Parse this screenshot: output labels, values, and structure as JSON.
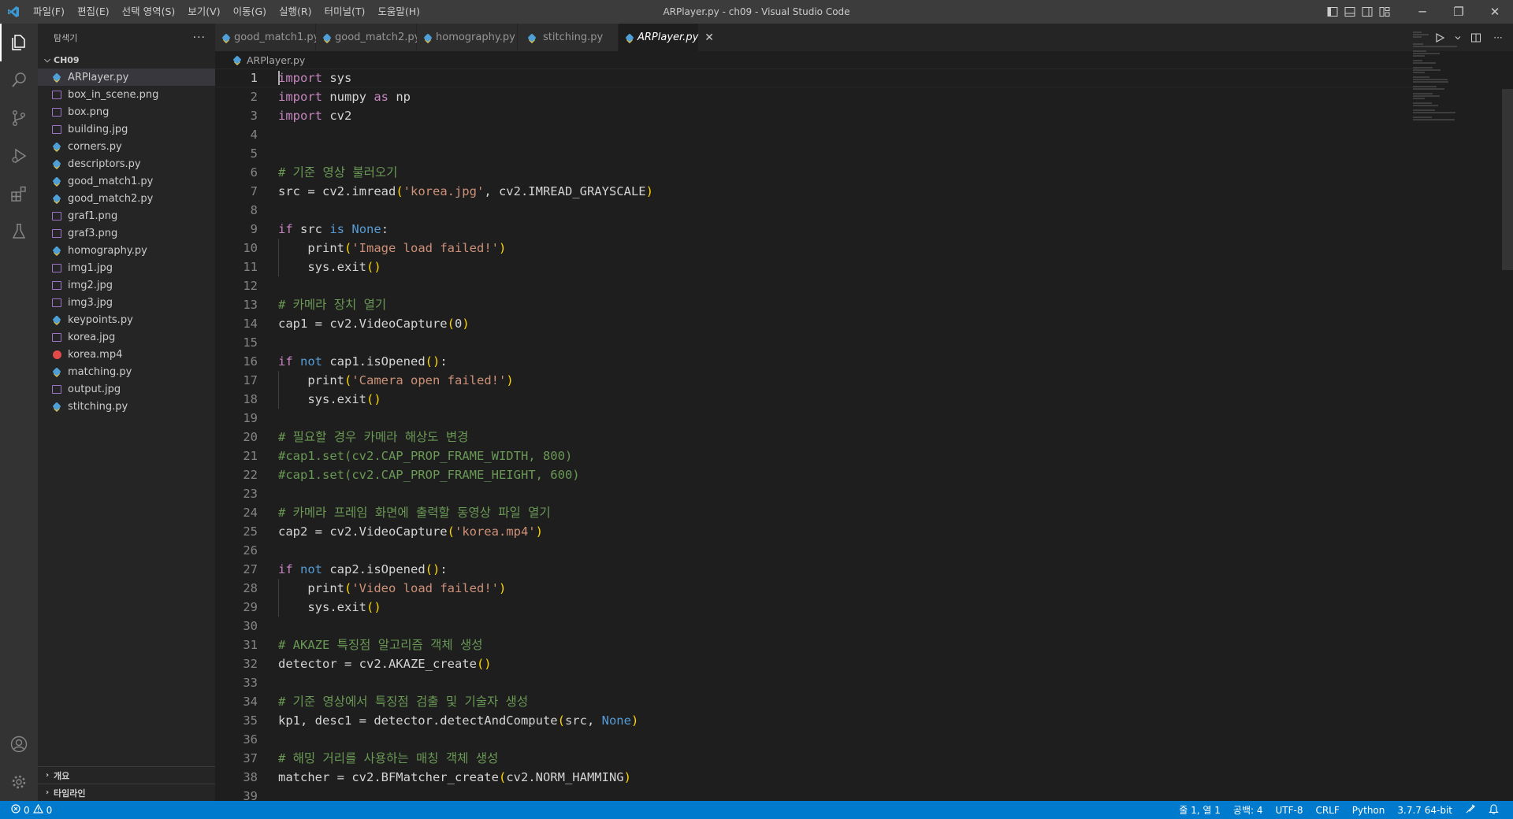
{
  "titlebar": {
    "title": "ARPlayer.py - ch09 - Visual Studio Code",
    "menu": [
      "파일(F)",
      "편집(E)",
      "선택 영역(S)",
      "보기(V)",
      "이동(G)",
      "실행(R)",
      "터미널(T)",
      "도움말(H)"
    ],
    "window_controls": {
      "minimize": "─",
      "restore": "❐",
      "close": "✕"
    }
  },
  "activitybar": {
    "items": [
      "explorer-icon",
      "search-icon",
      "source-control-icon",
      "run-debug-icon",
      "extensions-icon",
      "testing-icon"
    ],
    "bottom_items": [
      "account-icon",
      "settings-gear-icon"
    ]
  },
  "sidebar": {
    "title": "탐색기",
    "more": "···",
    "folder": "CH09",
    "files": [
      {
        "name": "ARPlayer.py",
        "type": "py"
      },
      {
        "name": "box_in_scene.png",
        "type": "img"
      },
      {
        "name": "box.png",
        "type": "img"
      },
      {
        "name": "building.jpg",
        "type": "img"
      },
      {
        "name": "corners.py",
        "type": "py"
      },
      {
        "name": "descriptors.py",
        "type": "py"
      },
      {
        "name": "good_match1.py",
        "type": "py"
      },
      {
        "name": "good_match2.py",
        "type": "py"
      },
      {
        "name": "graf1.png",
        "type": "img"
      },
      {
        "name": "graf3.png",
        "type": "img"
      },
      {
        "name": "homography.py",
        "type": "py"
      },
      {
        "name": "img1.jpg",
        "type": "img"
      },
      {
        "name": "img2.jpg",
        "type": "img"
      },
      {
        "name": "img3.jpg",
        "type": "img"
      },
      {
        "name": "keypoints.py",
        "type": "py"
      },
      {
        "name": "korea.jpg",
        "type": "img"
      },
      {
        "name": "korea.mp4",
        "type": "vid"
      },
      {
        "name": "matching.py",
        "type": "py"
      },
      {
        "name": "output.jpg",
        "type": "img"
      },
      {
        "name": "stitching.py",
        "type": "py"
      }
    ],
    "sections": [
      "개요",
      "타임라인"
    ]
  },
  "tabs": [
    {
      "label": "good_match1.py",
      "active": false
    },
    {
      "label": "good_match2.py",
      "active": false
    },
    {
      "label": "homography.py",
      "active": false
    },
    {
      "label": "stitching.py",
      "active": false
    },
    {
      "label": "ARPlayer.py",
      "active": true
    }
  ],
  "tab_close": "✕",
  "breadcrumb": "ARPlayer.py",
  "code": [
    [
      [
        "kw",
        "import"
      ],
      [
        "t",
        " sys"
      ]
    ],
    [
      [
        "kw",
        "import"
      ],
      [
        "t",
        " numpy "
      ],
      [
        "kw",
        "as"
      ],
      [
        "t",
        " np"
      ]
    ],
    [
      [
        "kw",
        "import"
      ],
      [
        "t",
        " cv2"
      ]
    ],
    [],
    [],
    [
      [
        "cm",
        "# 기준 영상 불러오기"
      ]
    ],
    [
      [
        "t",
        "src = cv2.imread"
      ],
      [
        "pn",
        "("
      ],
      [
        "str",
        "'korea.jpg'"
      ],
      [
        "t",
        ", cv2.IMREAD_GRAYSCALE"
      ],
      [
        "pn",
        ")"
      ]
    ],
    [],
    [
      [
        "kw",
        "if"
      ],
      [
        "t",
        " src "
      ],
      [
        "kb",
        "is"
      ],
      [
        "t",
        " "
      ],
      [
        "kb",
        "None"
      ],
      [
        "t",
        ":"
      ]
    ],
    [
      [
        "t",
        "    print"
      ],
      [
        "pn",
        "("
      ],
      [
        "str",
        "'Image load failed!'"
      ],
      [
        "pn",
        ")"
      ]
    ],
    [
      [
        "t",
        "    sys.exit"
      ],
      [
        "pn",
        "()"
      ]
    ],
    [],
    [
      [
        "cm",
        "# 카메라 장치 열기"
      ]
    ],
    [
      [
        "t",
        "cap1 = cv2.VideoCapture"
      ],
      [
        "pn",
        "("
      ],
      [
        "t",
        "0"
      ],
      [
        "pn",
        ")"
      ]
    ],
    [],
    [
      [
        "kw",
        "if"
      ],
      [
        "t",
        " "
      ],
      [
        "kb",
        "not"
      ],
      [
        "t",
        " cap1.isOpened"
      ],
      [
        "pn",
        "()"
      ],
      [
        "t",
        ":"
      ]
    ],
    [
      [
        "t",
        "    print"
      ],
      [
        "pn",
        "("
      ],
      [
        "str",
        "'Camera open failed!'"
      ],
      [
        "pn",
        ")"
      ]
    ],
    [
      [
        "t",
        "    sys.exit"
      ],
      [
        "pn",
        "()"
      ]
    ],
    [],
    [
      [
        "cm",
        "# 필요할 경우 카메라 해상도 변경"
      ]
    ],
    [
      [
        "cm",
        "#cap1.set(cv2.CAP_PROP_FRAME_WIDTH, 800)"
      ]
    ],
    [
      [
        "cm",
        "#cap1.set(cv2.CAP_PROP_FRAME_HEIGHT, 600)"
      ]
    ],
    [],
    [
      [
        "cm",
        "# 카메라 프레임 화면에 출력할 동영상 파일 열기"
      ]
    ],
    [
      [
        "t",
        "cap2 = cv2.VideoCapture"
      ],
      [
        "pn",
        "("
      ],
      [
        "str",
        "'korea.mp4'"
      ],
      [
        "pn",
        ")"
      ]
    ],
    [],
    [
      [
        "kw",
        "if"
      ],
      [
        "t",
        " "
      ],
      [
        "kb",
        "not"
      ],
      [
        "t",
        " cap2.isOpened"
      ],
      [
        "pn",
        "()"
      ],
      [
        "t",
        ":"
      ]
    ],
    [
      [
        "t",
        "    print"
      ],
      [
        "pn",
        "("
      ],
      [
        "str",
        "'Video load failed!'"
      ],
      [
        "pn",
        ")"
      ]
    ],
    [
      [
        "t",
        "    sys.exit"
      ],
      [
        "pn",
        "()"
      ]
    ],
    [],
    [
      [
        "cm",
        "# AKAZE 특징점 알고리즘 객체 생성"
      ]
    ],
    [
      [
        "t",
        "detector = cv2.AKAZE_create"
      ],
      [
        "pn",
        "()"
      ]
    ],
    [],
    [
      [
        "cm",
        "# 기준 영상에서 특징점 검출 및 기술자 생성"
      ]
    ],
    [
      [
        "t",
        "kp1, desc1 = detector.detectAndCompute"
      ],
      [
        "pn",
        "("
      ],
      [
        "t",
        "src, "
      ],
      [
        "kb",
        "None"
      ],
      [
        "pn",
        ")"
      ]
    ],
    [],
    [
      [
        "cm",
        "# 해밍 거리를 사용하는 매칭 객체 생성"
      ]
    ],
    [
      [
        "t",
        "matcher = cv2.BFMatcher_create"
      ],
      [
        "pn",
        "("
      ],
      [
        "t",
        "cv2.NORM_HAMMING"
      ],
      [
        "pn",
        ")"
      ]
    ],
    []
  ],
  "statusbar": {
    "errors": "0",
    "warnings": "0",
    "position": "줄 1, 열 1",
    "indent": "공백: 4",
    "encoding": "UTF-8",
    "eol": "CRLF",
    "language": "Python",
    "interpreter": "3.7.7 64-bit"
  },
  "colors": {
    "accent": "#007acc",
    "keyword": "#c586c0",
    "builtin": "#569cd6",
    "string": "#ce9178",
    "comment": "#6a9955",
    "bracket": "#ffd700"
  }
}
